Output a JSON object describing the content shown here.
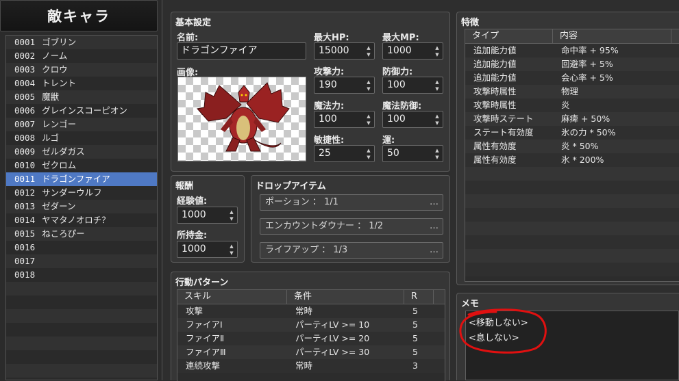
{
  "enemy_panel": {
    "title": "敵キャラ",
    "items": [
      {
        "num": "0001",
        "name": "ゴブリン"
      },
      {
        "num": "0002",
        "name": "ノーム"
      },
      {
        "num": "0003",
        "name": "クロウ"
      },
      {
        "num": "0004",
        "name": "トレント"
      },
      {
        "num": "0005",
        "name": "魔獣"
      },
      {
        "num": "0006",
        "name": "グレインスコーピオン"
      },
      {
        "num": "0007",
        "name": "レンゴー"
      },
      {
        "num": "0008",
        "name": "ルゴ"
      },
      {
        "num": "0009",
        "name": "ゼルダガス"
      },
      {
        "num": "0010",
        "name": "ゼクロム"
      },
      {
        "num": "0011",
        "name": "ドラゴンファイア"
      },
      {
        "num": "0012",
        "name": "サンダーウルフ"
      },
      {
        "num": "0013",
        "name": "ゼダーン"
      },
      {
        "num": "0014",
        "name": "ヤマタノオロチ？"
      },
      {
        "num": "0015",
        "name": "ねころぴー"
      },
      {
        "num": "0016",
        "name": ""
      },
      {
        "num": "0017",
        "name": ""
      },
      {
        "num": "0018",
        "name": ""
      }
    ],
    "selected_index": 10
  },
  "basic": {
    "title": "基本設定",
    "name_label": "名前:",
    "name_value": "ドラゴンファイア",
    "image_label": "画像:",
    "maxhp_label": "最大HP:",
    "maxhp": "15000",
    "maxmp_label": "最大MP:",
    "maxmp": "1000",
    "atk_label": "攻撃力:",
    "atk": "190",
    "def_label": "防御力:",
    "def": "100",
    "mat_label": "魔法力:",
    "mat": "100",
    "mdf_label": "魔法防御:",
    "mdf": "100",
    "agi_label": "敏捷性:",
    "agi": "25",
    "luk_label": "運:",
    "luk": "50"
  },
  "reward": {
    "title": "報酬",
    "exp_label": "経験値:",
    "exp": "1000",
    "gold_label": "所持金:",
    "gold": "1000"
  },
  "drops": {
    "title": "ドロップアイテム",
    "items": [
      "ポーション ： 1/1",
      "エンカウントダウナー ： 1/2",
      "ライフアップ ： 1/3"
    ],
    "ellipsis": "…"
  },
  "actions": {
    "title": "行動パターン",
    "headers": [
      "スキル",
      "条件",
      "R"
    ],
    "rows": [
      [
        "攻撃",
        "常時",
        "5"
      ],
      [
        "ファイアⅠ",
        "パーティLV >= 10",
        "5"
      ],
      [
        "ファイアⅡ",
        "パーティLV >= 20",
        "5"
      ],
      [
        "ファイアⅢ",
        "パーティLV >= 30",
        "5"
      ],
      [
        "連続攻撃",
        "常時",
        "3"
      ]
    ]
  },
  "traits": {
    "title": "特徴",
    "headers": [
      "タイプ",
      "内容"
    ],
    "rows": [
      [
        "追加能力値",
        "命中率 + 95%"
      ],
      [
        "追加能力値",
        "回避率 + 5%"
      ],
      [
        "追加能力値",
        "会心率 + 5%"
      ],
      [
        "攻撃時属性",
        "物理"
      ],
      [
        "攻撃時属性",
        "炎"
      ],
      [
        "攻撃時ステート",
        "麻痺 + 50%"
      ],
      [
        "ステート有効度",
        "氷の力 * 50%"
      ],
      [
        "属性有効度",
        "炎 * 50%"
      ],
      [
        "属性有効度",
        "氷 * 200%"
      ]
    ]
  },
  "memo": {
    "title": "メモ",
    "lines": [
      "<移動しない>",
      "<息しない>"
    ],
    "annotation_color": "#e01010"
  },
  "colors": {
    "selection": "#4f79c4",
    "panel_bg": "#363636",
    "window_bg": "#2b2b2b"
  }
}
